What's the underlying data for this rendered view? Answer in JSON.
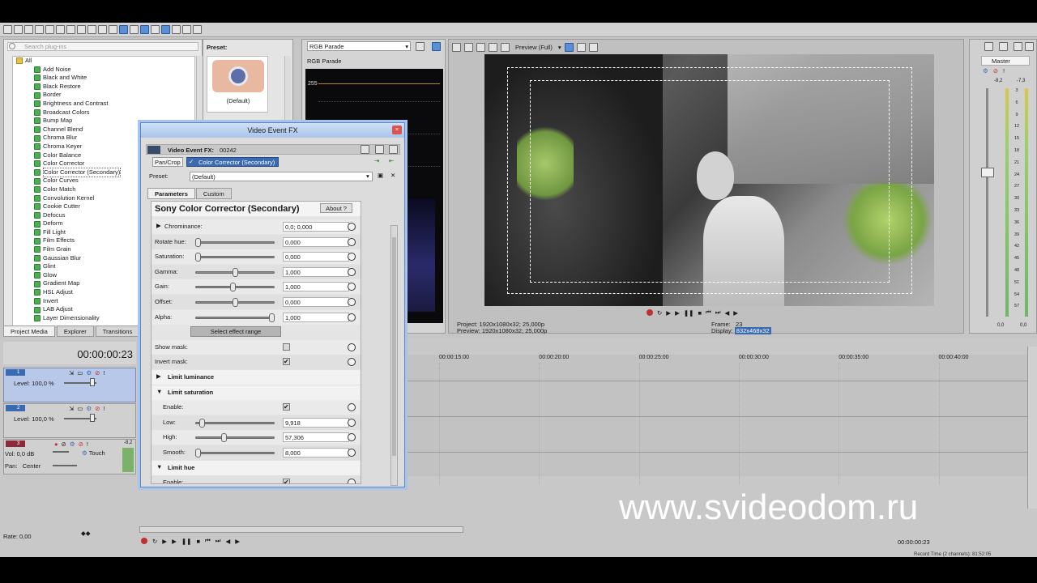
{
  "plugins": {
    "search_placeholder": "Search plug-ins",
    "root": "All",
    "items": [
      "Add Noise",
      "Black and White",
      "Black Restore",
      "Border",
      "Brightness and Contrast",
      "Broadcast Colors",
      "Bump Map",
      "Channel Blend",
      "Chroma Blur",
      "Chroma Keyer",
      "Color Balance",
      "Color Corrector",
      "Color Corrector (Secondary)",
      "Color Curves",
      "Color Match",
      "Convolution Kernel",
      "Cookie Cutter",
      "Defocus",
      "Deform",
      "Fill Light",
      "Film Effects",
      "Film Grain",
      "Gaussian Blur",
      "Glint",
      "Glow",
      "Gradient Map",
      "HSL Adjust",
      "Invert",
      "LAB Adjust",
      "Layer Dimensionality"
    ],
    "selected_index": 12,
    "preset_label": "Preset:",
    "preset_default": "(Default)",
    "tabs": [
      "Project Media",
      "Explorer",
      "Transitions"
    ]
  },
  "scope": {
    "select_value": "RGB Parade",
    "title": "RGB Parade",
    "level_255": "255"
  },
  "preview": {
    "mode": "Preview (Full)",
    "project_label": "Project:",
    "project_value": "1920x1080x32; 25,000p",
    "preview_label": "Preview:",
    "preview_value": "1920x1080x32; 25,000p",
    "frame_label": "Frame:",
    "frame_value": "23",
    "display_label": "Display:",
    "display_value": "832x468x32"
  },
  "master": {
    "title": "Master",
    "peak_left": "-8,2",
    "peak_right": "-7,3",
    "scale": [
      "3",
      "6",
      "9",
      "12",
      "15",
      "18",
      "21",
      "24",
      "27",
      "30",
      "33",
      "36",
      "39",
      "42",
      "45",
      "48",
      "51",
      "54",
      "57"
    ],
    "bottom_left": "0,0",
    "bottom_right": "0,0"
  },
  "timeline": {
    "timecode": "00:00:00:23",
    "ruler": [
      "00:00:15:00",
      "00:00:20:00",
      "00:00:25:00",
      "00:00:30:00",
      "00:00:35:00",
      "00:00:40:00"
    ],
    "tracks": [
      {
        "num": "1",
        "level": "Level: 100,0 %"
      },
      {
        "num": "2",
        "level": "Level: 100,0 %"
      }
    ],
    "audio": {
      "num": "3",
      "vol_label": "Vol:",
      "vol_value": "0,0 dB",
      "pan_label": "Pan:",
      "pan_value": "Center",
      "mode": "Touch",
      "meter": "-8,2"
    },
    "rate": "Rate: 0,00",
    "bottom_timecode": "00:00:00:23",
    "record_time": "Record Time (2 channels): 81:52:05"
  },
  "fx_dialog": {
    "title": "Video Event FX",
    "label": "Video Event FX:",
    "event_id": "00242",
    "chain": [
      "Pan/Crop",
      "Color Corrector (Secondary)"
    ],
    "preset_label": "Preset:",
    "preset_value": "(Default)",
    "tabs": [
      "Parameters",
      "Custom"
    ],
    "plugin_title": "Sony Color Corrector (Secondary)",
    "about": "About",
    "help": "?",
    "params": {
      "chrominance": {
        "label": "Chrominance:",
        "value": "0,0; 0,000"
      },
      "rotate_hue": {
        "label": "Rotate hue:",
        "value": "0,000",
        "level": 0.0
      },
      "saturation": {
        "label": "Saturation:",
        "value": "0,000",
        "level": 0.0
      },
      "gamma": {
        "label": "Gamma:",
        "value": "1,000",
        "level": 0.5
      },
      "gain": {
        "label": "Gain:",
        "value": "1,000",
        "level": 0.47
      },
      "offset": {
        "label": "Offset:",
        "value": "0,000",
        "level": 0.5
      },
      "alpha": {
        "label": "Alpha:",
        "value": "1,000",
        "level": 1.0
      }
    },
    "select_range": "Select effect range",
    "show_mask": "Show mask:",
    "invert_mask": "Invert mask:",
    "limit_luminance": "Limit luminance",
    "limit_saturation": "Limit saturation",
    "sat_enable": "Enable:",
    "low": {
      "label": "Low:",
      "value": "9,918",
      "level": 0.05
    },
    "high": {
      "label": "High:",
      "value": "57,306",
      "level": 0.35
    },
    "smooth": {
      "label": "Smooth:",
      "value": "8,000",
      "level": 0.0
    },
    "limit_hue": "Limit hue",
    "hue_enable": "Enable:"
  },
  "watermark": "www.svideodom.ru"
}
